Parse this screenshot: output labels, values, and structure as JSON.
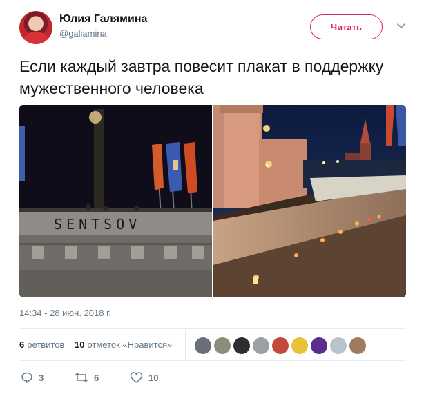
{
  "user": {
    "name": "Юлия Галямина",
    "handle": "@galiamina",
    "follow_label": "Читать"
  },
  "tweet": {
    "text": "Если каждый завтра повесит плакат в поддержку мужественного человека",
    "timestamp": "14:34 - 28 июн. 2018 г.",
    "photo_left_sign": "SENTSOV"
  },
  "stats": {
    "retweets_count": "6",
    "retweets_label": "ретвитов",
    "likes_count": "10",
    "likes_label": "отметок «Нравится»"
  },
  "actions": {
    "reply_count": "3",
    "retweet_count": "6",
    "like_count": "10"
  },
  "colors": {
    "accent": "#e0245e",
    "muted": "#657786",
    "text": "#14171a",
    "border": "#e6ecf0"
  },
  "icons": {
    "caret": "chevron-down-icon",
    "reply": "reply-icon",
    "retweet": "retweet-icon",
    "like": "heart-icon"
  }
}
